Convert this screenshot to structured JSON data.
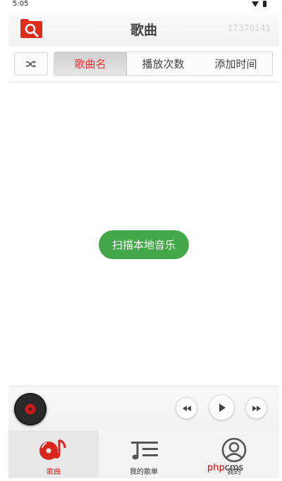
{
  "status": {
    "time": "5:05"
  },
  "header": {
    "title": "歌曲",
    "user_id": "17370141"
  },
  "sort_tabs": [
    {
      "label": "歌曲名",
      "active": true
    },
    {
      "label": "播放次数",
      "active": false
    },
    {
      "label": "添加时间",
      "active": false
    }
  ],
  "scan_button": {
    "label": "扫描本地音乐"
  },
  "nav": {
    "songs": "歌曲",
    "my_playlists": "我的歌单",
    "me": "我的"
  },
  "watermark": {
    "php": "php",
    "cms": "cms"
  },
  "colors": {
    "accent": "#e33333",
    "scan": "#43a84a"
  }
}
